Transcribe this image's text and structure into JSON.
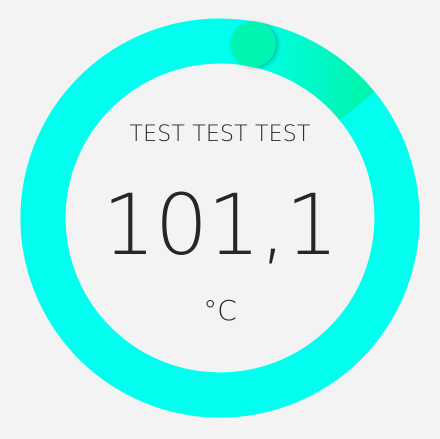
{
  "gauge": {
    "title": "TEST TEST TEST",
    "value": "101,1",
    "unit": "°C",
    "progress": 0.97,
    "colors": {
      "background": "#f3f3f3",
      "track": "#00ffee",
      "progress_end": "#00f5b0",
      "text": "#262626"
    }
  }
}
